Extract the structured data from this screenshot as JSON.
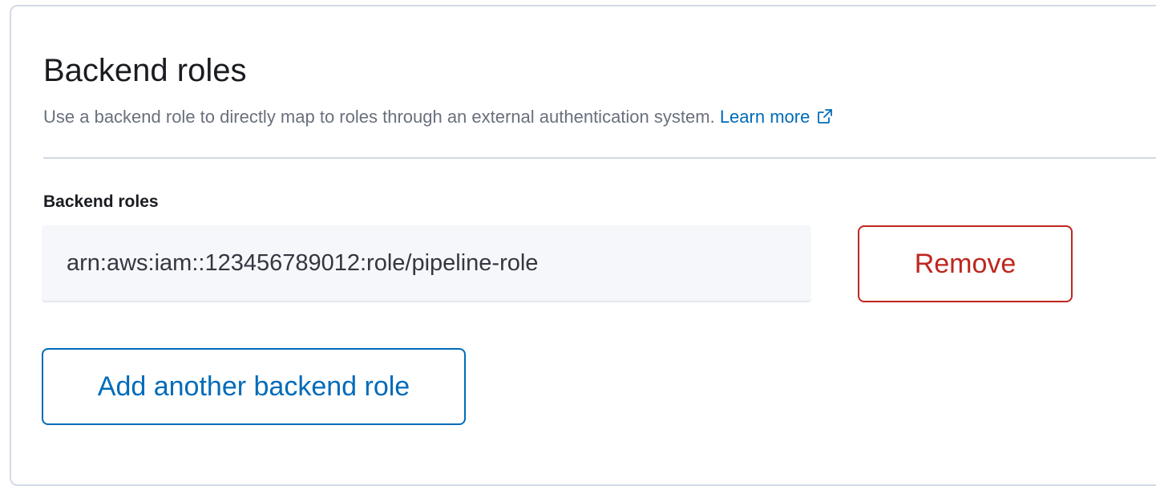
{
  "section": {
    "title": "Backend roles",
    "description": "Use a backend role to directly map to roles through an external authentication system.",
    "learn_more_label": "Learn more",
    "learn_more_icon": "external-link-icon"
  },
  "field": {
    "label": "Backend roles",
    "value": "arn:aws:iam::123456789012:role/pipeline-role"
  },
  "actions": {
    "remove_label": "Remove",
    "add_label": "Add another backend role"
  },
  "colors": {
    "link": "#006bb8",
    "danger": "#bd271e",
    "border": "#d3dae6"
  }
}
